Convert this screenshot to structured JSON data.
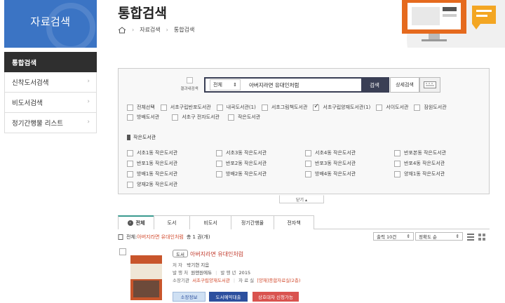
{
  "sidebar": {
    "title": "자료검색",
    "items": [
      {
        "label": "통합검색",
        "active": true
      },
      {
        "label": "신착도서검색"
      },
      {
        "label": "비도서검색"
      },
      {
        "label": "정기간행물 리스트"
      }
    ]
  },
  "header": {
    "title": "통합검색",
    "breadcrumb": [
      "자료검색",
      "통합검색"
    ]
  },
  "search": {
    "within_results_label": "결과내검색",
    "field_select": "전체",
    "query": "아버지라면 유대인처럼",
    "search_button": "검색",
    "advanced_button": "상세검색",
    "libraries": [
      {
        "label": "전체선택",
        "checked": false
      },
      {
        "label": "서초구립반포도서관",
        "checked": false
      },
      {
        "label": "내곡도서관(1)",
        "checked": false
      },
      {
        "label": "서초그림책도서관",
        "checked": false
      },
      {
        "label": "서초구립양재도서관(1)",
        "checked": true
      },
      {
        "label": "서이도서관",
        "checked": false
      },
      {
        "label": "잠원도서관",
        "checked": false
      },
      {
        "label": "방배도서관",
        "checked": false
      },
      {
        "label": "서초구 전자도서관",
        "checked": false
      },
      {
        "label": "작은도서관",
        "checked": false
      }
    ],
    "small_libraries_title": "작은도서관",
    "small_libraries": [
      "서초1동 작은도서관",
      "서초3동 작은도서관",
      "서초4동 작은도서관",
      "반포본동 작은도서관",
      "반포1동 작은도서관",
      "반포2동 작은도서관",
      "반포3동 작은도서관",
      "반포4동 작은도서관",
      "방배1동 작은도서관",
      "방배2동 작은도서관",
      "방배4동 작은도서관",
      "양재1동 작은도서관",
      "양재2동 작은도서관"
    ],
    "collapse_label": "닫기 ▴"
  },
  "tabs": [
    "전체",
    "도서",
    "비도서",
    "정기간행물",
    "전자책"
  ],
  "results": {
    "prefix": "전체:",
    "query": "아버지라면 유대인처럼",
    "count_text": "총 1 권(개)",
    "per_page": "출력 10건",
    "sort": "정확도 순"
  },
  "item": {
    "type": "도서",
    "title": "아버지라면 유대인처럼",
    "author_label": "저 자",
    "author": "박기현 지음",
    "publisher_label": "발 행 처",
    "publisher": "원앤원에듀",
    "year_label": "발 행 년",
    "year": "2015",
    "location_label": "소장기관",
    "location": "서초구립양재도서관",
    "room_label": "자 료 실",
    "room": "[양재]종합자료실(2층)",
    "btn_holdings": "소장정보",
    "btn_reserve": "도서예약대출",
    "btn_loan": "상호대차 신청가능",
    "colors": {
      "holdings": "#cfe0f3",
      "reserve": "#2c4f9e",
      "loan": "#d9534f"
    }
  }
}
